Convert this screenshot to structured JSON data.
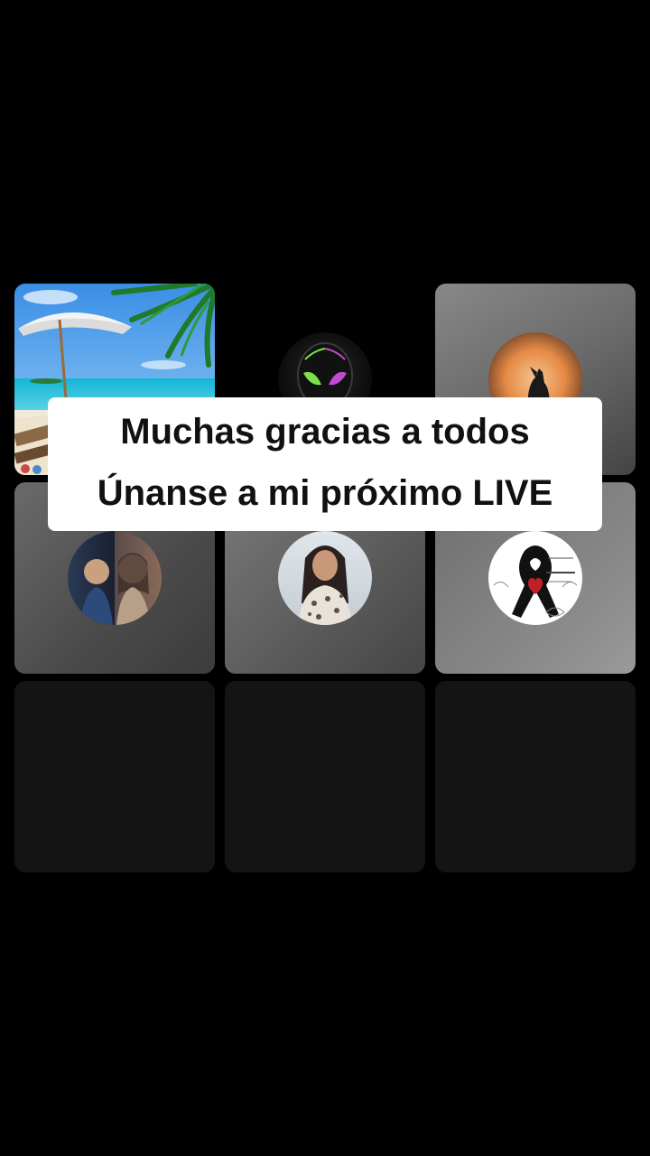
{
  "caption": {
    "line1": "Muchas gracias a todos",
    "line2": "Únanse a mi próximo LIVE"
  },
  "grid": {
    "tiles": [
      {
        "icon": "beach-palm-image"
      },
      {
        "icon": "alien-head-avatar"
      },
      {
        "icon": "howling-wolf-moon-avatar"
      },
      {
        "icon": "couple-photo-avatar"
      },
      {
        "icon": "woman-portrait-avatar"
      },
      {
        "icon": "black-ribbon-heart-avatar"
      },
      {
        "icon": "empty-slot"
      },
      {
        "icon": "empty-slot"
      },
      {
        "icon": "empty-slot"
      }
    ]
  }
}
